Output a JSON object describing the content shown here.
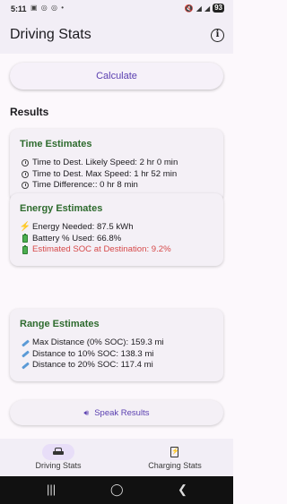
{
  "status_bar": {
    "time": "5:11",
    "left_icons": "▣ ◎ ◎ •",
    "battery": "93"
  },
  "app_bar": {
    "title": "Driving Stats",
    "info_icon": "info-icon"
  },
  "calculate_label": "Calculate",
  "results_heading": "Results",
  "time_card": {
    "title": "Time Estimates",
    "items": [
      "Time to Dest. Likely Speed: 2 hr 0 min",
      "Time to Dest. Max Speed: 1 hr 52 min",
      "Time Difference:: 0 hr 8 min"
    ]
  },
  "energy_card": {
    "title": "Energy Estimates",
    "items": [
      "Energy Needed: 87.5 kWh",
      "Battery % Used: 66.8%",
      "Estimated SOC at Destination: 9.2%"
    ],
    "warning_color": "#d64848"
  },
  "range_card": {
    "title": "Range Estimates",
    "items": [
      "Max Distance (0% SOC): 159.3 mi",
      "Distance to 10% SOC: 138.3 mi",
      "Distance to 20% SOC: 117.4 mi"
    ]
  },
  "speak_label": "Speak Results",
  "bottom_nav": {
    "items": [
      {
        "label": "Driving Stats",
        "icon": "car-icon",
        "active": true
      },
      {
        "label": "Charging Stats",
        "icon": "ev-charger-icon",
        "active": false
      }
    ]
  },
  "system_nav": {
    "recents": "|||",
    "home": "◯",
    "back": "❮"
  },
  "colors": {
    "accent": "#5a3fb0",
    "card_title": "#2e6b2e",
    "background": "#fcf8fc"
  }
}
